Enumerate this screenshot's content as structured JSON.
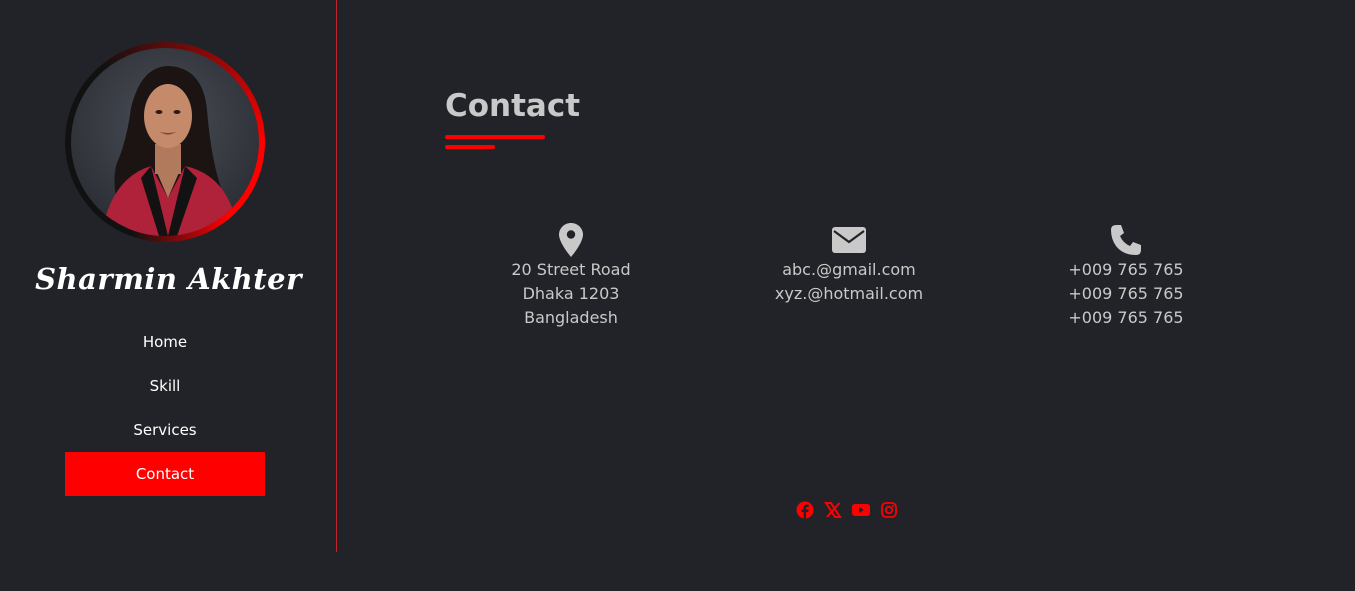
{
  "profile": {
    "name": "Sharmin Akhter"
  },
  "nav": {
    "items": [
      "Home",
      "Skill",
      "Services",
      "Contact"
    ],
    "active": "Contact"
  },
  "contact": {
    "title": "Contact",
    "address": [
      "20 Street Road",
      "Dhaka 1203",
      "Bangladesh"
    ],
    "emails": [
      "abc.@gmail.com",
      "xyz.@hotmail.com"
    ],
    "phones": [
      "+009 765 765",
      "+009 765 765",
      "+009 765 765"
    ],
    "icons": [
      "map-marker-icon",
      "envelope-icon",
      "phone-icon"
    ]
  },
  "social": {
    "icons": [
      "facebook-icon",
      "x-twitter-icon",
      "youtube-icon",
      "instagram-icon"
    ]
  },
  "colors": {
    "accent": "#ff0000",
    "background": "#212328",
    "text": "#c9c9c9",
    "white": "#ffffff"
  }
}
